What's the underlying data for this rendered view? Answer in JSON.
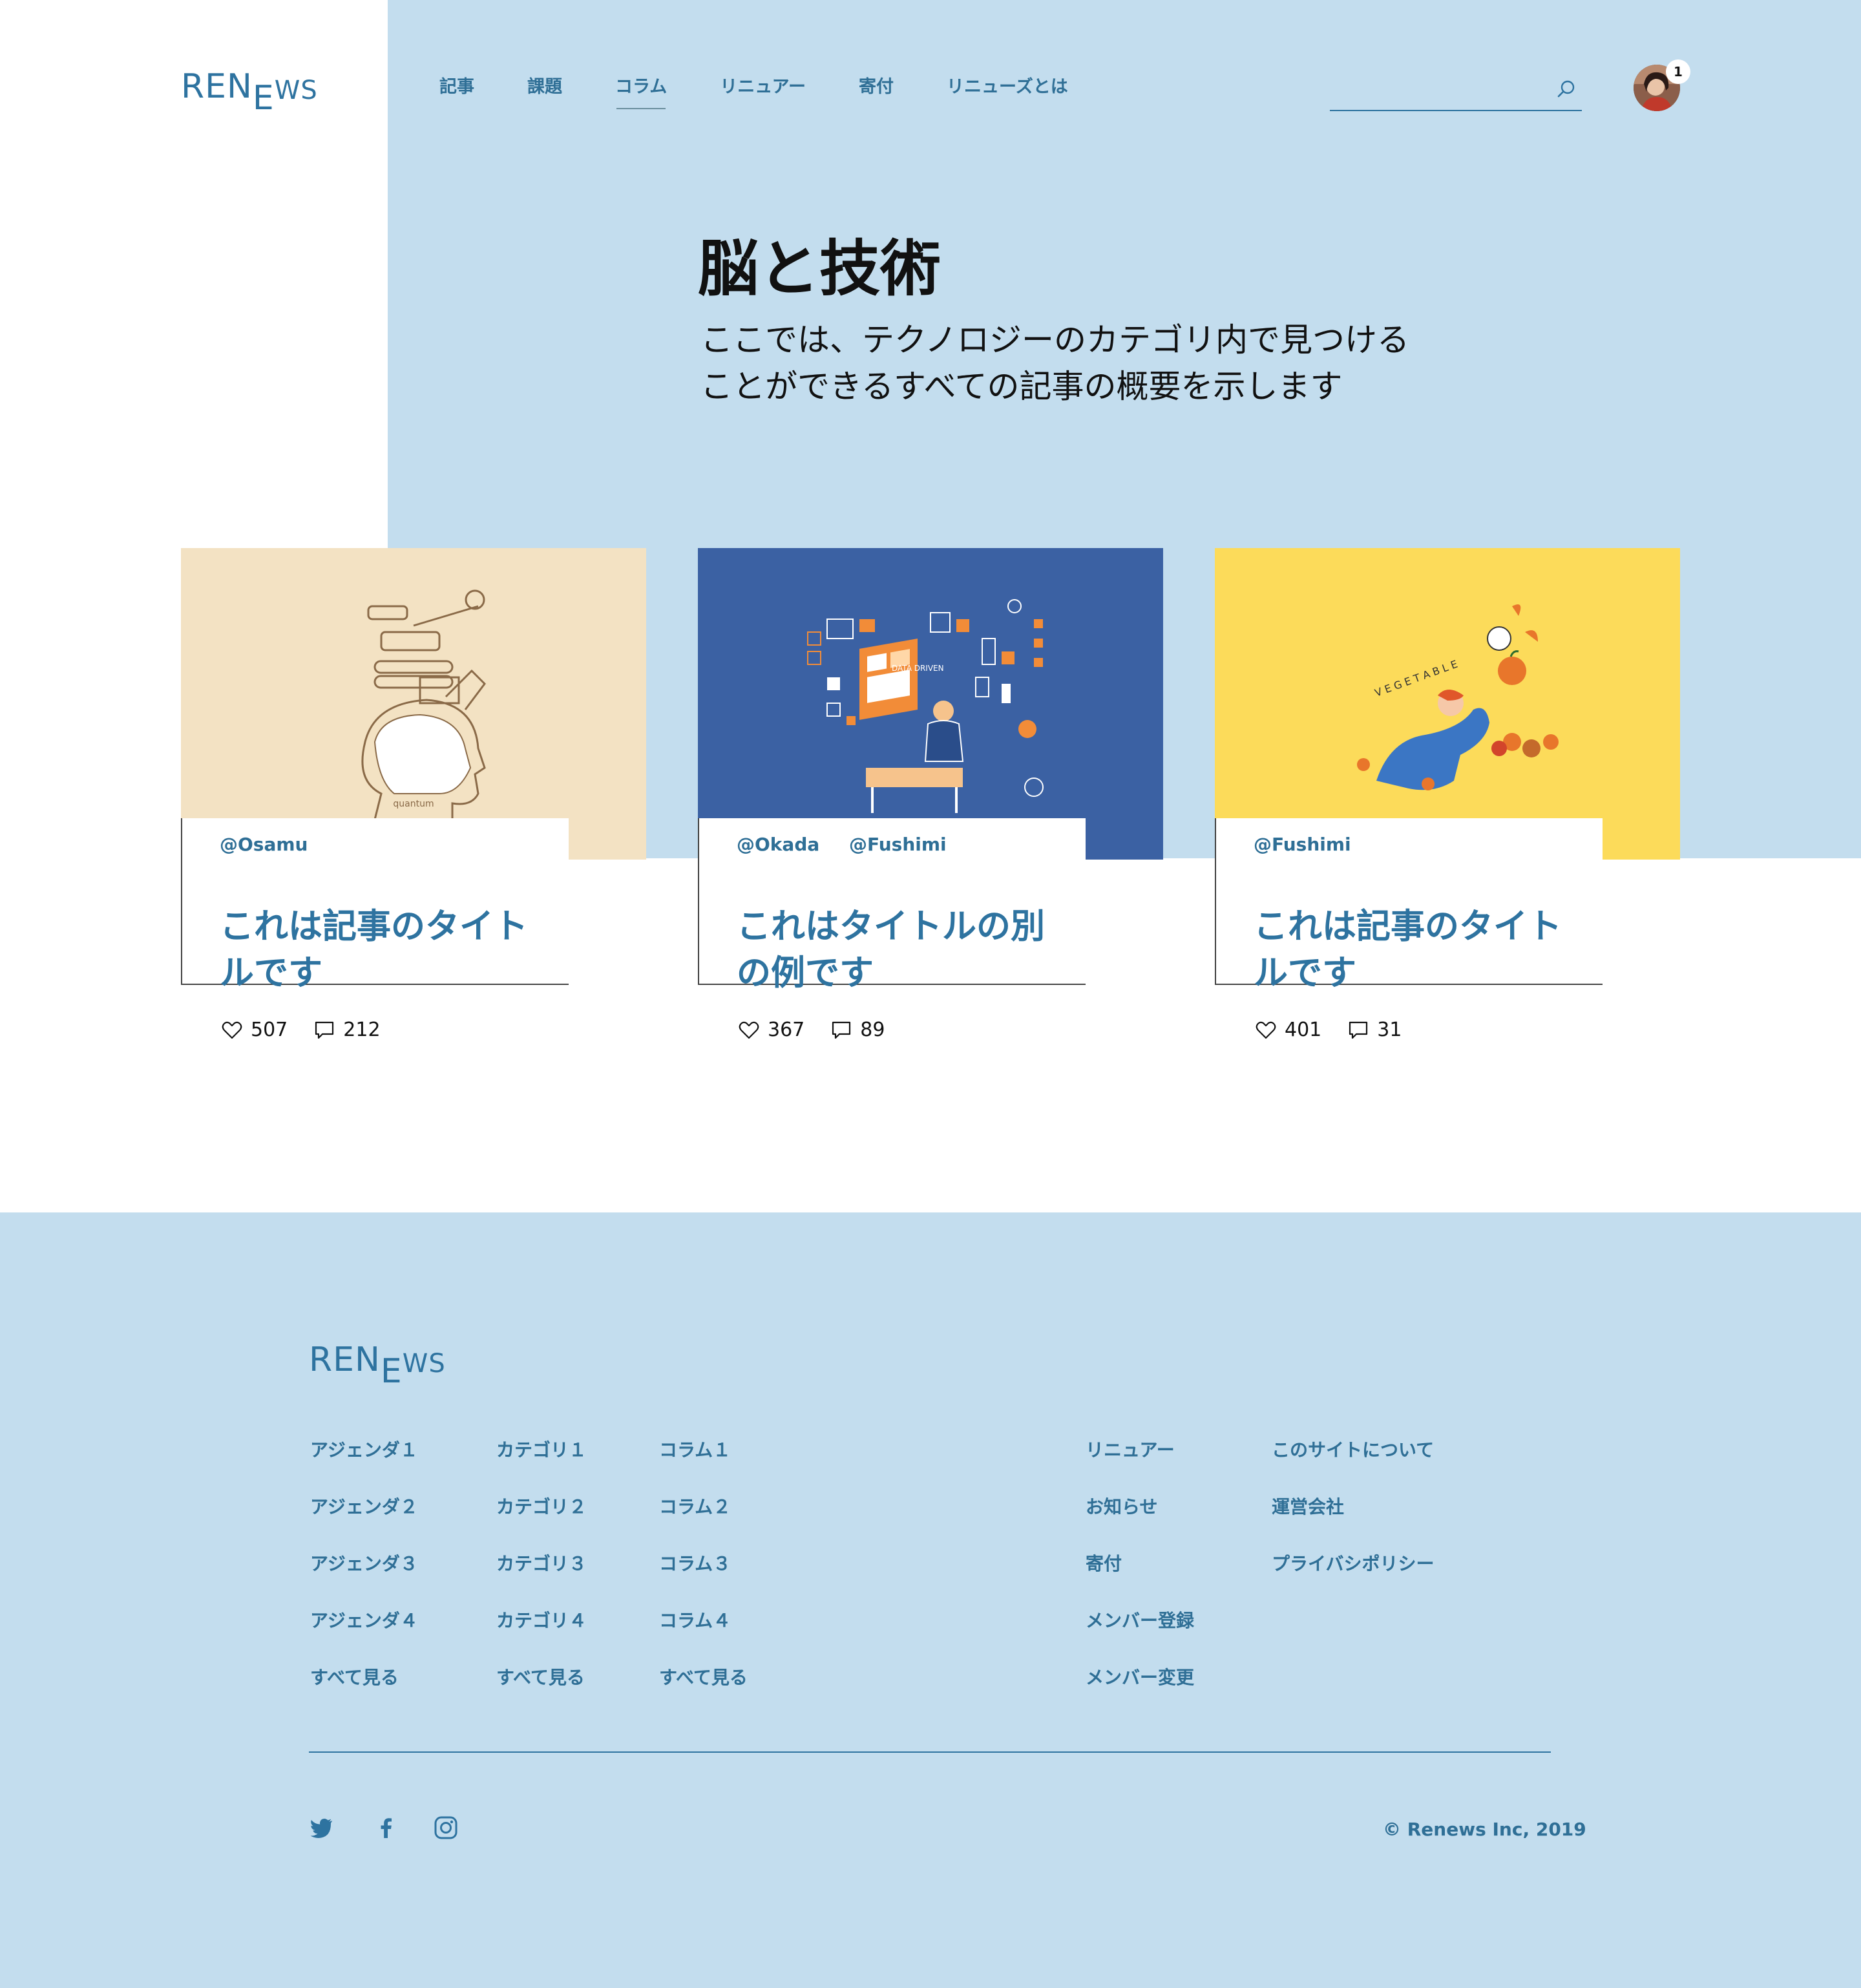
{
  "header": {
    "logo": {
      "r": "R",
      "e": "E",
      "n": "N",
      "e2": "E",
      "ws": "WS"
    },
    "nav": [
      "記事",
      "課題",
      "コラム",
      "リニュアー",
      "寄付",
      "リニューズとは"
    ],
    "active_nav": "コラム",
    "search": {
      "value": "",
      "placeholder": ""
    },
    "notification_count": "1"
  },
  "hero": {
    "title": "脳と技術",
    "subtitle_line1": "ここでは、テクノロジーのカテゴリ内で見つける",
    "subtitle_line2": "ことができるすべての記事の概要を示します"
  },
  "cards": [
    {
      "authors": [
        "@Osamu"
      ],
      "title": "これは記事のタイトルです",
      "likes": "507",
      "comments": "212",
      "image_bg": "#f3e2c3",
      "image_icon": "brain-quantum-illustration"
    },
    {
      "authors": [
        "@Okada",
        "@Fushimi"
      ],
      "title": "これはタイトルの別の例です",
      "likes": "367",
      "comments": "89",
      "image_bg": "#3b61a3",
      "image_icon": "data-driven-illustration",
      "image_caption": "DATA DRIVEN"
    },
    {
      "authors": [
        "@Fushimi"
      ],
      "title": "これは記事のタイトルです",
      "likes": "401",
      "comments": "31",
      "image_bg": "#fcdb5a",
      "image_icon": "vegetable-illustration"
    }
  ],
  "footer": {
    "columns": [
      [
        "アジェンダ１",
        "アジェンダ２",
        "アジェンダ３",
        "アジェンダ４",
        "すべて見る"
      ],
      [
        "カテゴリ１",
        "カテゴリ２",
        "カテゴリ３",
        "カテゴリ４",
        "すべて見る"
      ],
      [
        "コラム１",
        "コラム２",
        "コラム３",
        "コラム４",
        "すべて見る"
      ],
      [
        "リニュアー",
        "お知らせ",
        "寄付",
        "メンバー登録",
        "メンバー変更"
      ],
      [
        "このサイトについて",
        "運営会社",
        "プライバシポリシー"
      ]
    ],
    "social": [
      "twitter-icon",
      "facebook-icon",
      "instagram-icon"
    ],
    "copyright": "© Renews Inc, 2019"
  },
  "colors": {
    "accent": "#2e73a0",
    "hero_bg": "#c3ddee",
    "text_dark": "#111111"
  }
}
